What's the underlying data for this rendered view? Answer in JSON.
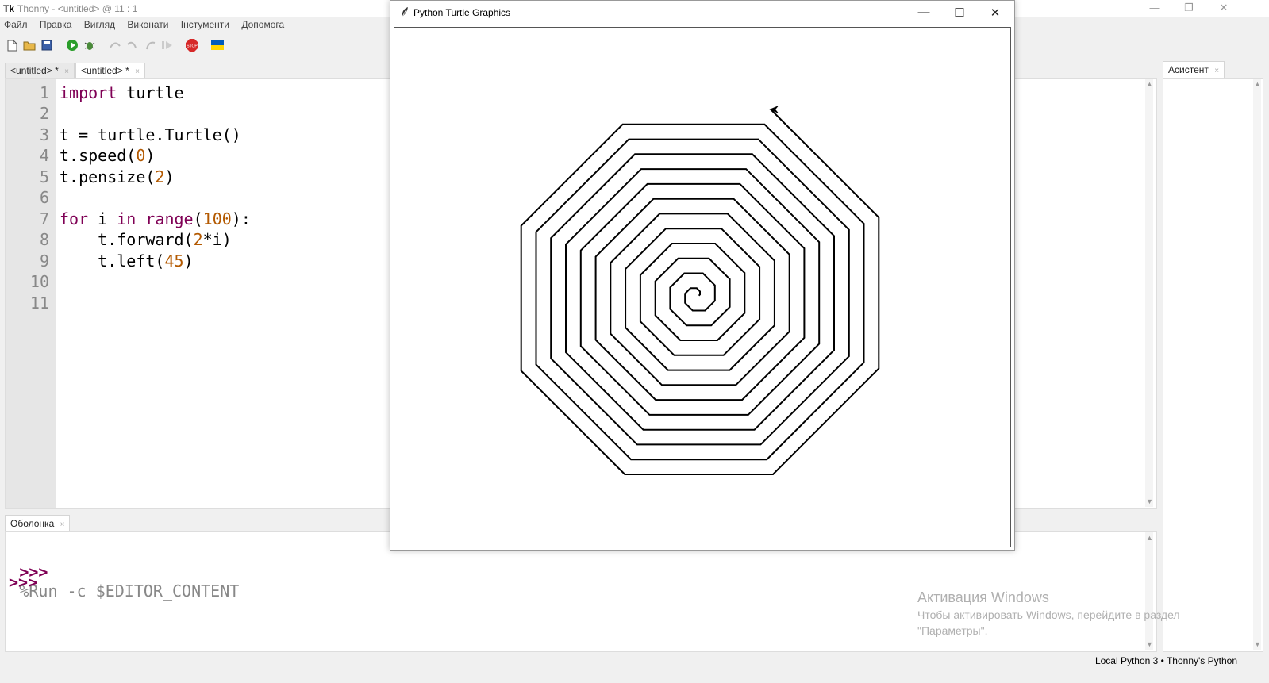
{
  "window": {
    "title": "Thonny  -  <untitled>  @  11 : 1",
    "icon_label": "Tk"
  },
  "menu": [
    "Файл",
    "Правка",
    "Вигляд",
    "Виконати",
    "Інстументи",
    "Допомога"
  ],
  "toolbar": {
    "icons": [
      "new-file-icon",
      "open-file-icon",
      "save-icon",
      "run-icon",
      "debug-icon",
      "step-over-icon",
      "step-into-icon",
      "step-out-icon",
      "resume-icon",
      "stop-icon",
      "ukraine-flag-icon"
    ],
    "stop_label": "STOP",
    "colors": {
      "run": "#2a9d2a",
      "stop": "#d62828",
      "flag_blue": "#005bbb",
      "flag_yellow": "#ffd500"
    }
  },
  "tabs": [
    {
      "label": "<untitled>",
      "modified": "*",
      "close": "×"
    },
    {
      "label": "<untitled>",
      "modified": "*",
      "close": "×"
    }
  ],
  "editor": {
    "line_numbers": [
      "1",
      "2",
      "3",
      "4",
      "5",
      "6",
      "7",
      "8",
      "9",
      "10",
      "11"
    ]
  },
  "shell": {
    "tab_label": "Оболонка",
    "close": "×",
    "prompt": ">>>",
    "command": "%Run -c $EDITOR_CONTENT"
  },
  "assistant": {
    "tab_label": "Асистент",
    "close": "×"
  },
  "turtle": {
    "title": "Python Turtle Graphics",
    "iterations": 100,
    "step": 2,
    "angle": 45,
    "pen_size": 2
  },
  "watermark": {
    "title": "Активация Windows",
    "line1": "Чтобы активировать Windows, перейдите в раздел",
    "line2": "\"Параметры\"."
  },
  "status": {
    "text": "Local Python 3  •  Thonny's Python"
  }
}
